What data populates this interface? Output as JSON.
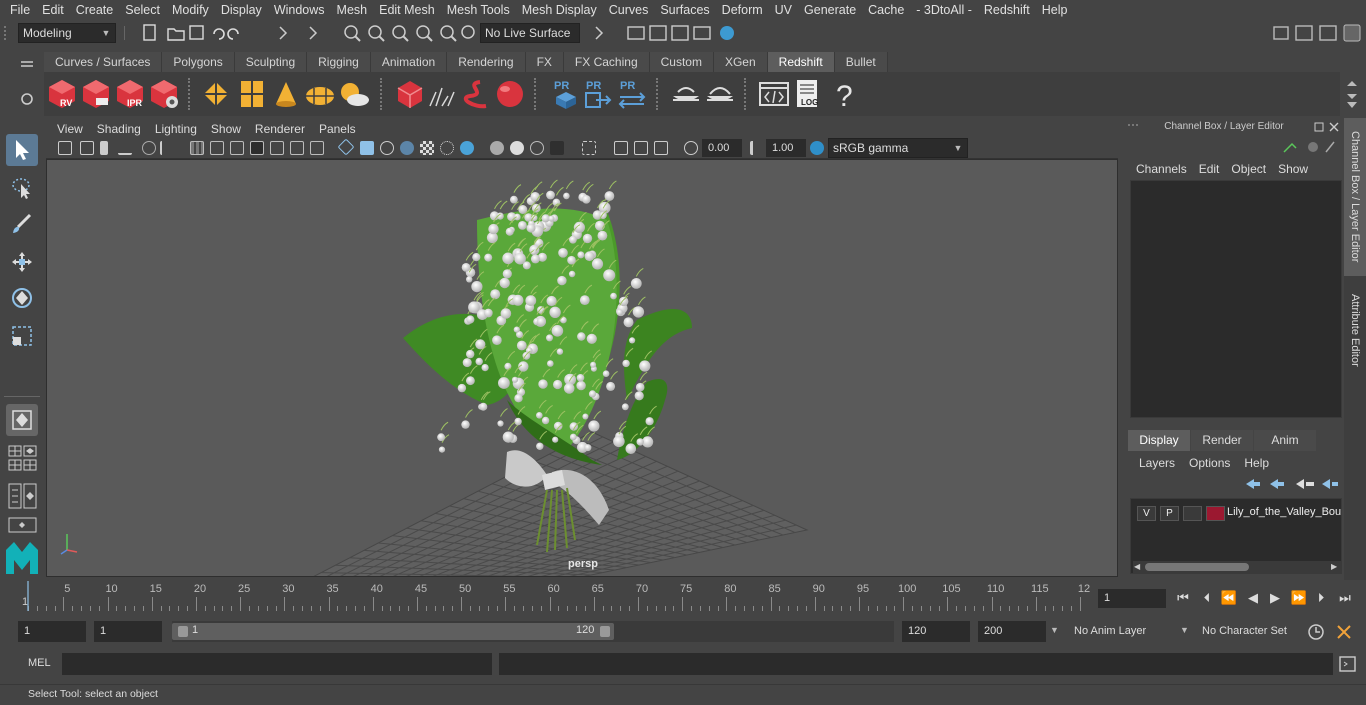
{
  "menu": [
    "File",
    "Edit",
    "Create",
    "Select",
    "Modify",
    "Display",
    "Windows",
    "Mesh",
    "Edit Mesh",
    "Mesh Tools",
    "Mesh Display",
    "Curves",
    "Surfaces",
    "Deform",
    "UV",
    "Generate",
    "Cache",
    "- 3DtoAll -",
    "Redshift",
    "Help"
  ],
  "status_line": {
    "mode": "Modeling",
    "live_surface": "No Live Surface"
  },
  "shelf_tabs": [
    "Curves / Surfaces",
    "Polygons",
    "Sculpting",
    "Rigging",
    "Animation",
    "Rendering",
    "FX",
    "FX Caching",
    "Custom",
    "XGen",
    "Redshift",
    "Bullet"
  ],
  "shelf_active": "Redshift",
  "shelf_icon_labels": {
    "rv": "RV",
    "ipr": "IPR",
    "pr": "PR",
    "log": "LOG",
    "help": "?"
  },
  "panel_menu": [
    "View",
    "Shading",
    "Lighting",
    "Show",
    "Renderer",
    "Panels"
  ],
  "panel_tools": {
    "exposure": "0.00",
    "gamma": "1.00",
    "color_space": "sRGB gamma"
  },
  "viewport": {
    "camera_label": "persp"
  },
  "channel_box": {
    "title": "Channel Box / Layer Editor",
    "menu": [
      "Channels",
      "Edit",
      "Object",
      "Show"
    ]
  },
  "layer_editor": {
    "tabs": [
      "Display",
      "Render",
      "Anim"
    ],
    "active_tab": "Display",
    "menu": [
      "Layers",
      "Options",
      "Help"
    ],
    "layers": [
      {
        "v": "V",
        "p": "P",
        "name": "Lily_of_the_Valley_Bou",
        "color": "#9b1830"
      }
    ]
  },
  "side_tabs": [
    "Channel Box / Layer Editor",
    "Attribute Editor"
  ],
  "time_slider": {
    "start": 1,
    "end": 120,
    "labels": [
      "5",
      "10",
      "15",
      "20",
      "25",
      "30",
      "35",
      "40",
      "45",
      "50",
      "55",
      "60",
      "65",
      "70",
      "75",
      "80",
      "85",
      "90",
      "95",
      "100",
      "105",
      "110",
      "115",
      "12"
    ],
    "first_label": "1",
    "current_frame": "1"
  },
  "range_slider": {
    "start_field": "1",
    "start_inner": "1",
    "range_start": "1",
    "range_end": "120",
    "end_field": "120",
    "anim_end": "200",
    "anim_layer": "No Anim Layer",
    "character_set": "No Character Set"
  },
  "command_line": {
    "label": "MEL"
  },
  "help_line": "Select Tool: select an object",
  "colors": {
    "accent_blue": "#5c9fd8",
    "redshift_red": "#d9343e",
    "layer_color": "#9b1830"
  }
}
